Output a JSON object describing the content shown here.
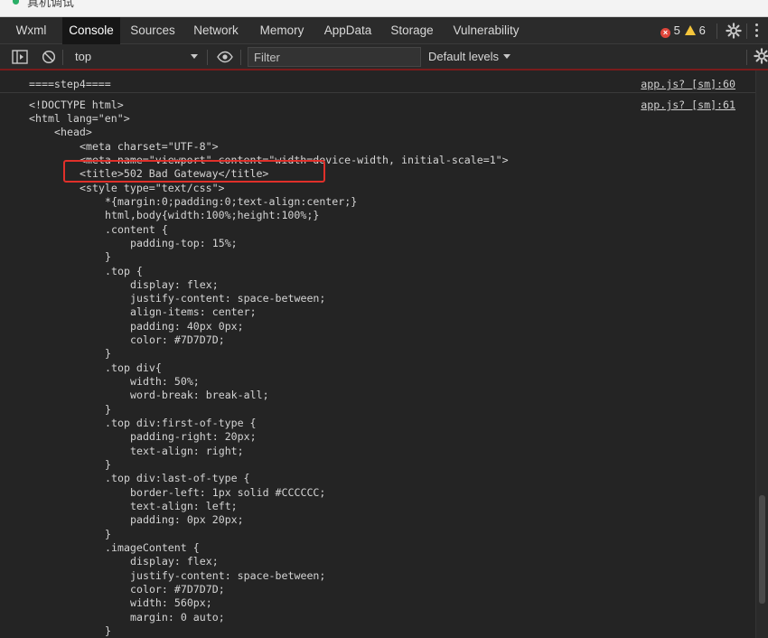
{
  "top_strip": {
    "text": "真机调试"
  },
  "tabs": [
    {
      "label": "Wxml"
    },
    {
      "label": "Console"
    },
    {
      "label": "Sources"
    },
    {
      "label": "Network"
    },
    {
      "label": "Memory"
    },
    {
      "label": "AppData"
    },
    {
      "label": "Storage"
    },
    {
      "label": "Vulnerability"
    }
  ],
  "active_tab": "Console",
  "status": {
    "errors": "5",
    "warnings": "6"
  },
  "filter_bar": {
    "context": "top",
    "filter_placeholder": "Filter",
    "levels": "Default levels"
  },
  "console": {
    "messages": [
      {
        "text": "====step4====",
        "source": "app.js? [sm]:60"
      },
      {
        "text": "<!DOCTYPE html>",
        "source": "app.js? [sm]:61"
      }
    ],
    "code_lines": [
      "<html lang=\"en\">",
      "    <head>",
      "        <meta charset=\"UTF-8\">",
      "        <meta name=\"viewport\" content=\"width=device-width, initial-scale=1\">",
      "        <title>502 Bad Gateway</title>",
      "        <style type=\"text/css\">",
      "            *{margin:0;padding:0;text-align:center;}",
      "            html,body{width:100%;height:100%;}",
      "            .content {",
      "                padding-top: 15%;",
      "            }",
      "            .top {",
      "                display: flex;",
      "                justify-content: space-between;",
      "                align-items: center;",
      "                padding: 40px 0px;",
      "                color: #7D7D7D;",
      "            }",
      "            .top div{",
      "                width: 50%;",
      "                word-break: break-all;",
      "            }",
      "            .top div:first-of-type {",
      "                padding-right: 20px;",
      "                text-align: right;",
      "            }",
      "            .top div:last-of-type {",
      "                border-left: 1px solid #CCCCCC;",
      "                text-align: left;",
      "                padding: 0px 20px;",
      "            }",
      "            .imageContent {",
      "                display: flex;",
      "                justify-content: space-between;",
      "                color: #7D7D7D;",
      "                width: 560px;",
      "                margin: 0 auto;",
      "            }"
    ]
  },
  "colors": {
    "background": "#242424",
    "toolbar": "#2b2b2b",
    "active_tab": "#161616",
    "highlight_border": "#e0302a",
    "error": "#e0463b",
    "warning": "#f5c53b"
  },
  "icons": [
    "sidebar-toggle-icon",
    "clear-console-icon",
    "eye-icon",
    "gear-icon",
    "more-icon",
    "error-icon",
    "warning-icon"
  ]
}
